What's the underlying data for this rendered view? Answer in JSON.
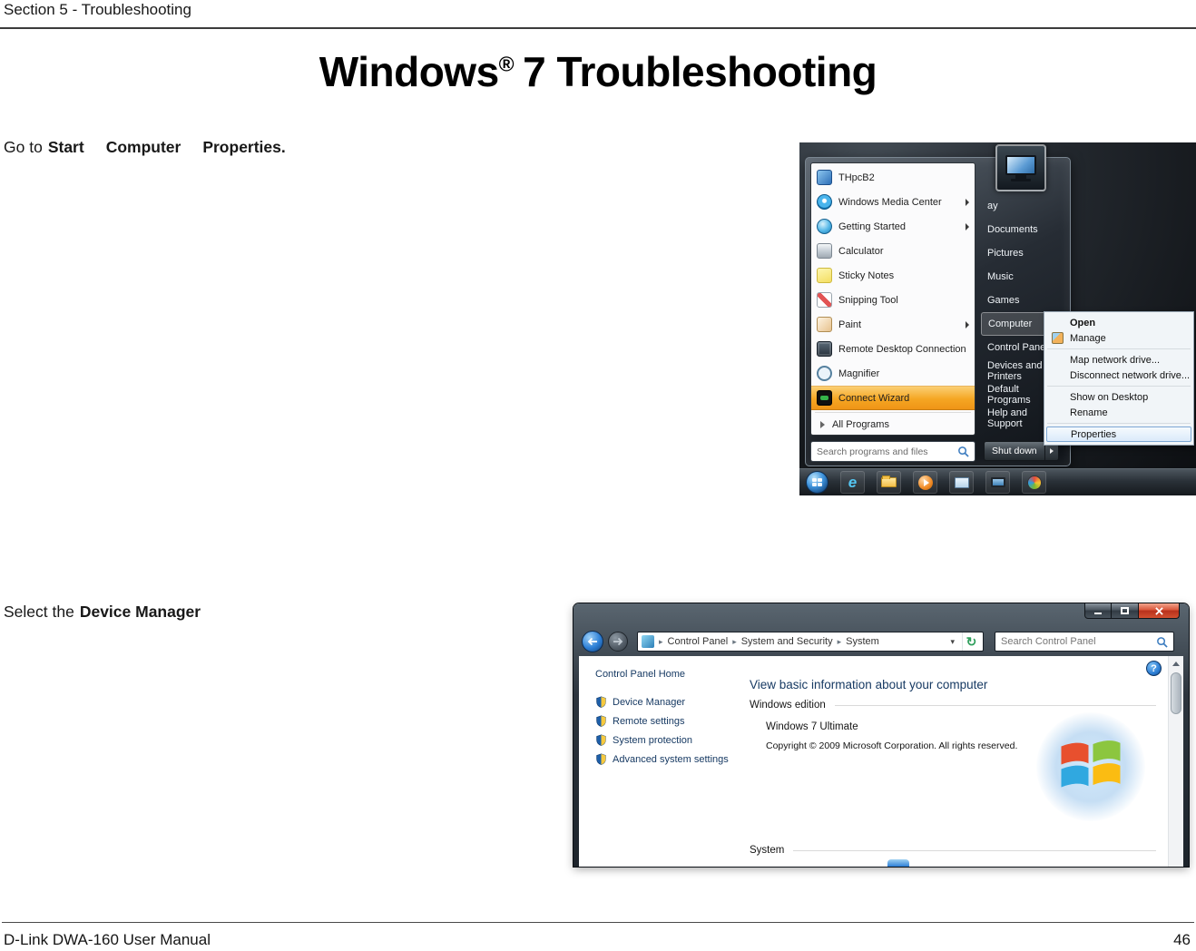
{
  "page": {
    "section_header": "Section 5 - Troubleshooting",
    "title_brand": "Windows",
    "title_reg": "®",
    "title_rest": "7 Troubleshooting",
    "instruction1": {
      "prefix": "Go to",
      "step1": "Start",
      "step2": "Computer",
      "step3": "Properties."
    },
    "instruction2": {
      "prefix": "Select the",
      "target": "Device Manager"
    },
    "footer": {
      "manual_name": "D-Link DWA-160 User Manual",
      "page_number": "46"
    }
  },
  "icons": {
    "crumb_sep": "▸",
    "caret": "▾",
    "refresh_glyph": "↻",
    "help_glyph": "?",
    "ie_glyph": "e"
  },
  "start_menu": {
    "left_items": [
      {
        "label": "THpcB2"
      },
      {
        "label": "Windows Media Center"
      },
      {
        "label": "Getting Started"
      },
      {
        "label": "Calculator"
      },
      {
        "label": "Sticky Notes"
      },
      {
        "label": "Snipping Tool"
      },
      {
        "label": "Paint"
      },
      {
        "label": "Remote Desktop Connection"
      },
      {
        "label": "Magnifier"
      },
      {
        "label": "Connect Wizard"
      }
    ],
    "all_programs_label": "All Programs",
    "search_placeholder": "Search programs and files",
    "user_label": "ay",
    "right_items": [
      "Documents",
      "Pictures",
      "Music",
      "Games",
      "Computer",
      "Control Panel",
      "Devices and Printers",
      "Default Programs",
      "Help and Support"
    ],
    "shutdown_label": "Shut down",
    "context_menu": {
      "open": "Open",
      "manage": "Manage",
      "map": "Map network drive...",
      "disconnect": "Disconnect network drive...",
      "show": "Show on Desktop",
      "rename": "Rename",
      "properties": "Properties"
    }
  },
  "system_window": {
    "breadcrumbs": [
      "Control Panel",
      "System and Security",
      "System"
    ],
    "search_placeholder": "Search Control Panel",
    "sidebar": {
      "home": "Control Panel Home",
      "links": [
        "Device Manager",
        "Remote settings",
        "System protection",
        "Advanced system settings"
      ]
    },
    "main": {
      "heading": "View basic information about your computer",
      "windows_edition_label": "Windows edition",
      "edition": "Windows 7 Ultimate",
      "copyright": "Copyright © 2009 Microsoft Corporation.  All rights reserved.",
      "system_label": "System"
    }
  }
}
